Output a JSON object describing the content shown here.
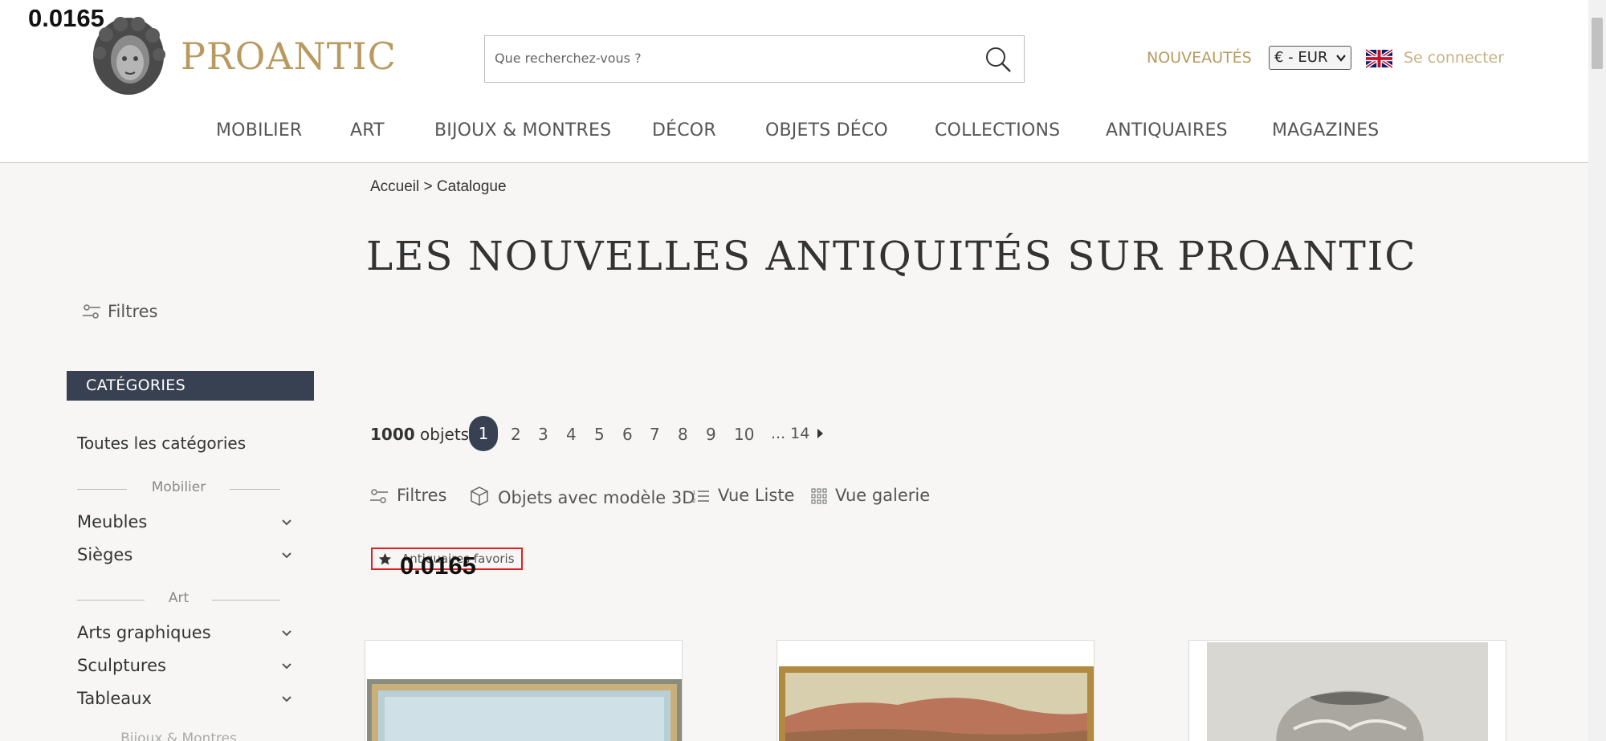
{
  "overlay": {
    "score_top": "0.0165",
    "score_mid": "0.0165"
  },
  "header": {
    "logo_text": "PROANTIC",
    "search_placeholder": "Que recherchez-vous ?",
    "nouveautes": "NOUVEAUTÉS",
    "currency": "€ - EUR",
    "login": "Se connecter"
  },
  "nav": {
    "items": [
      "MOBILIER",
      "ART",
      "BIJOUX & MONTRES",
      "DÉCOR",
      "OBJETS DÉCO",
      "COLLECTIONS",
      "ANTIQUAIRES",
      "MAGAZINES"
    ]
  },
  "breadcrumb": "Accueil > Catalogue",
  "page_title": "LES NOUVELLES ANTIQUITÉS SUR PROANTIC",
  "sidebar": {
    "filters_label": "Filtres",
    "categories_header": "CATÉGORIES",
    "all_categories": "Toutes les catégories",
    "sections": [
      {
        "label": "Mobilier",
        "items": [
          "Meubles",
          "Sièges"
        ]
      },
      {
        "label": "Art",
        "items": [
          "Arts graphiques",
          "Sculptures",
          "Tableaux"
        ]
      }
    ],
    "partial_section": "Bijoux & Montres"
  },
  "results": {
    "count_number": "1000",
    "count_label": "objets",
    "pages": [
      "1",
      "2",
      "3",
      "4",
      "5",
      "6",
      "7",
      "8",
      "9",
      "10",
      "... 14"
    ],
    "current_page": "1"
  },
  "toolbar": {
    "filters": "Filtres",
    "models_3d": "Objets avec modèle 3D",
    "list_view": "Vue Liste",
    "gallery_view": "Vue galerie"
  },
  "favorite_button": "Antiquaires favoris",
  "colors": {
    "accent_gold": "#b89a60",
    "dark_navy": "#384152",
    "page_bg": "#f7f6f4",
    "highlight_red": "#e12020"
  }
}
